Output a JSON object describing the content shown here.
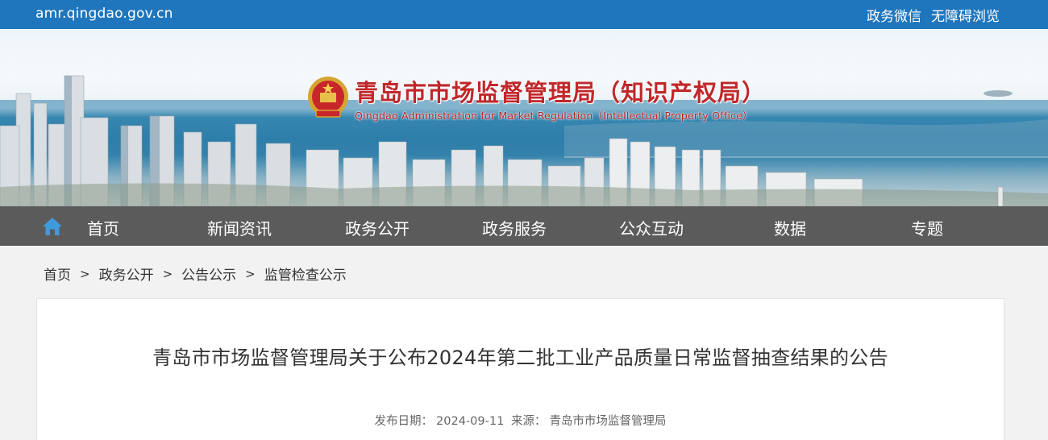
{
  "topbar": {
    "domain": "amr.qingdao.gov.cn",
    "links": [
      "政务微信",
      "无障碍浏览"
    ]
  },
  "header": {
    "title": "青岛市市场监督管理局（知识产权局）",
    "subtitle": "Qingdao Administration for Market Regulation（Intellectual Property Office）"
  },
  "nav": {
    "items": [
      "首页",
      "新闻资讯",
      "政务公开",
      "政务服务",
      "公众互动",
      "数据",
      "专题"
    ]
  },
  "breadcrumb": {
    "items": [
      "首页",
      "政务公开",
      "公告公示",
      "监管检查公示"
    ],
    "separator": ">"
  },
  "article": {
    "title": "青岛市市场监督管理局关于公布2024年第二批工业产品质量日常监督抽查结果的公告",
    "date_label": "发布日期：",
    "date": "2024-09-11",
    "source_label": "来源：",
    "source": "青岛市市场监督管理局"
  },
  "colors": {
    "topbar": "#1f76bd",
    "nav": "#5b5b5b",
    "title_red": "#c0282b"
  }
}
